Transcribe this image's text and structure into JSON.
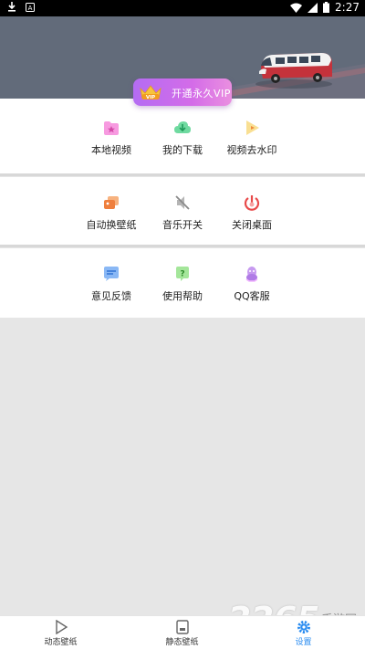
{
  "status_bar": {
    "time": "2:27"
  },
  "vip_button": {
    "badge": "VIP",
    "label": "开通永久VIP"
  },
  "section_media": [
    {
      "label": "本地视频",
      "icon": "folder-star-icon",
      "color": "#f37bd3"
    },
    {
      "label": "我的下载",
      "icon": "cloud-download-icon",
      "color": "#3fcf86"
    },
    {
      "label": "视频去水印",
      "icon": "play-triangle-icon",
      "color": "#f5c04a"
    }
  ],
  "section_settings": [
    {
      "label": "自动换壁纸",
      "icon": "image-swap-icon",
      "color": "#f08a4b"
    },
    {
      "label": "音乐开关",
      "icon": "music-off-icon",
      "color": "#9a9a9a"
    },
    {
      "label": "关闭桌面",
      "icon": "power-icon",
      "color": "#e84a4a"
    }
  ],
  "section_help": [
    {
      "label": "意见反馈",
      "icon": "feedback-message-icon",
      "color": "#5b9cf0"
    },
    {
      "label": "使用帮助",
      "icon": "help-bubble-icon",
      "color": "#62cf5b"
    },
    {
      "label": "QQ客服",
      "icon": "qq-penguin-icon",
      "color": "#b97be8"
    }
  ],
  "tabbar": [
    {
      "label": "动态壁纸",
      "icon": "play-icon",
      "active": false
    },
    {
      "label": "静态壁纸",
      "icon": "picture-icon",
      "active": false
    },
    {
      "label": "设置",
      "icon": "gear-icon",
      "active": true
    }
  ],
  "watermark": {
    "number": "2265",
    "text": "手游网"
  },
  "colors": {
    "accent": "#2a8cf0",
    "vip_gradient_start": "#b46cf3",
    "vip_gradient_end": "#ea8fe0",
    "banner_bg": "#626b7a"
  }
}
